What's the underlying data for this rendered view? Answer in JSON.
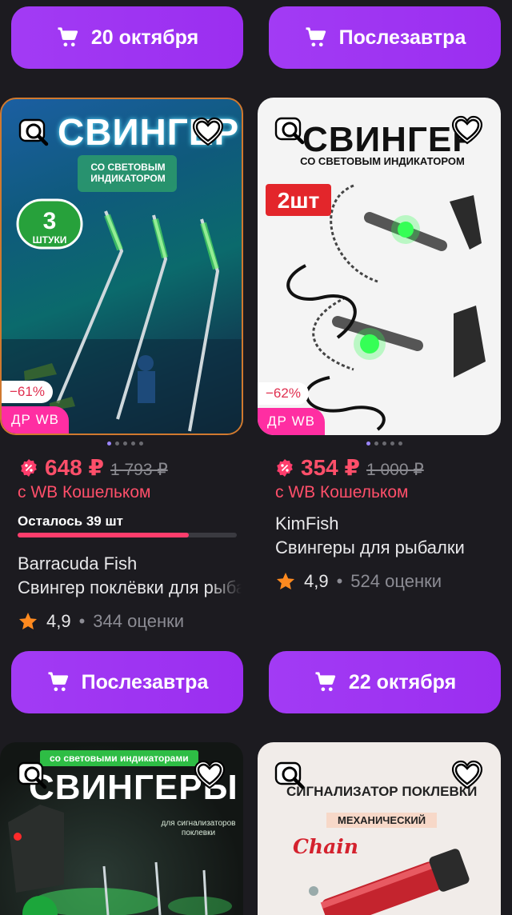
{
  "buttons_top": [
    {
      "label": "20 октября"
    },
    {
      "label": "Послезавтра"
    }
  ],
  "products": [
    {
      "image_title": "СВИНГЕР",
      "image_subtitle": "СО СВЕТОВЫМ ИНДИКАТОРОМ",
      "image_badge": "3 ШТУКИ",
      "discount": "−61%",
      "tag": "ДР WB",
      "price": "648 ₽",
      "old_price": "1 793 ₽",
      "wallet": "с WB Кошельком",
      "stock": "Осталось 39 шт",
      "stock_fraction": 0.78,
      "brand": "Barracuda Fish",
      "title": "Свингер поклёвки для рыбалки",
      "rating": "4,9",
      "reviews": "344 оценки"
    },
    {
      "image_title": "СВИНГЕР",
      "image_subtitle": "СО СВЕТОВЫМ ИНДИКАТОРОМ",
      "image_badge": "2шт",
      "discount": "−62%",
      "tag": "ДР WB",
      "price": "354 ₽",
      "old_price": "1 000 ₽",
      "wallet": "с WB Кошельком",
      "brand": "KimFish",
      "title": "Свингеры для рыбалки",
      "rating": "4,9",
      "reviews": "524 оценки"
    }
  ],
  "buttons_mid": [
    {
      "label": "Послезавтра"
    },
    {
      "label": "22 октября"
    }
  ],
  "bottom_cards": [
    {
      "top_text": "со световыми индикаторами",
      "title": "СВИНГЕРЫ",
      "side_text": "для сигнализаторов поклевки"
    },
    {
      "title": "СИГНАЛИЗАТОР ПОКЛЕВКИ",
      "subtitle": "МЕХАНИЧЕСКИЙ",
      "accent": "Chain"
    }
  ],
  "colors": {
    "accent": "#9b2ef0",
    "price": "#ff4f6a",
    "star": "#ff8a1f"
  }
}
